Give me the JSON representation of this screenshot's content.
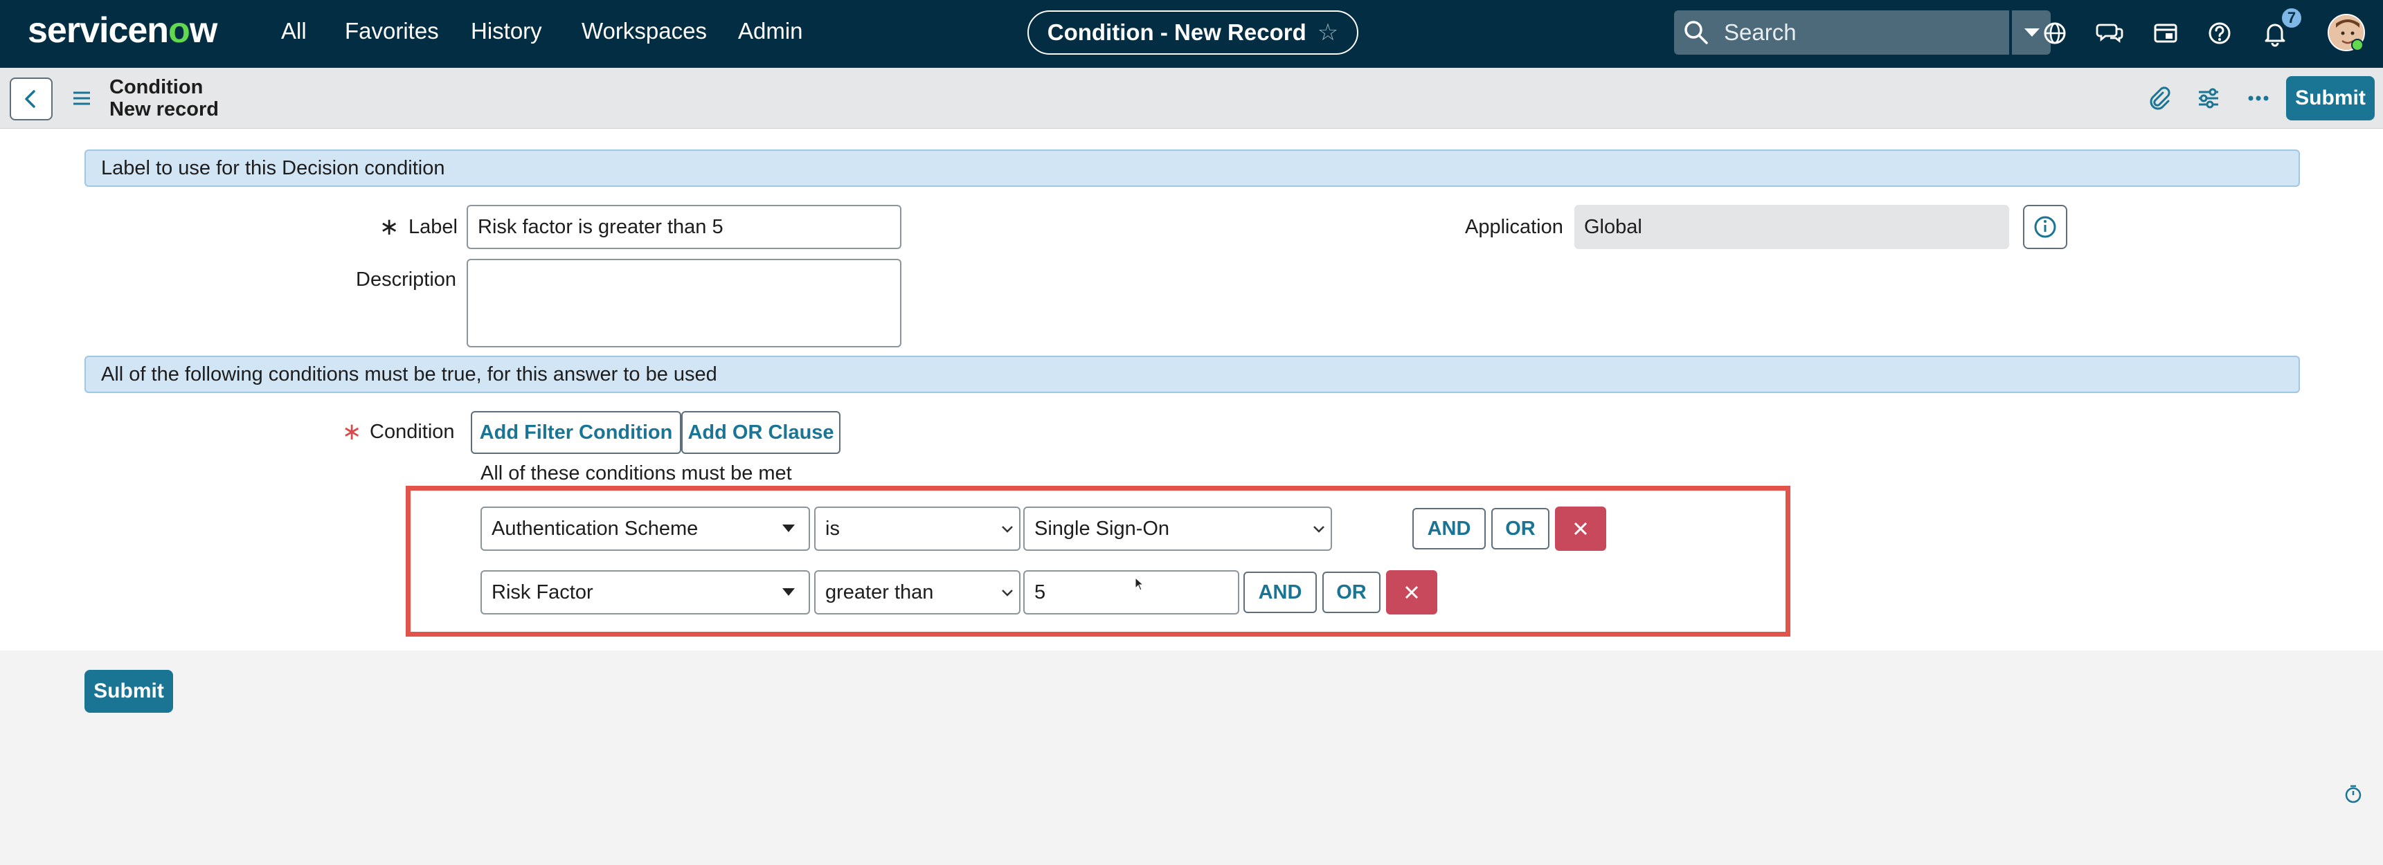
{
  "topnav": {
    "logo": "servicenow",
    "links": [
      "All",
      "Favorites",
      "History",
      "Workspaces",
      "Admin"
    ],
    "record_title": "Condition - New Record",
    "search_placeholder": "Search",
    "notification_count": "7"
  },
  "header": {
    "breadcrumb_table": "Condition",
    "breadcrumb_record": "New record",
    "submit_label": "Submit"
  },
  "form": {
    "section1": "Label to use for this Decision condition",
    "label_label": "Label",
    "label_value": "Risk factor is greater than 5",
    "application_label": "Application",
    "application_value": "Global",
    "description_label": "Description",
    "description_value": "",
    "section2": "All of the following conditions must be true, for this answer to be used",
    "condition_label": "Condition",
    "add_filter_label": "Add Filter Condition",
    "add_or_label": "Add OR Clause",
    "conditions_hint": "All of these conditions must be met",
    "rows": [
      {
        "field": "Authentication Scheme",
        "operator": "is",
        "value": "Single Sign-On",
        "and": "AND",
        "or": "OR"
      },
      {
        "field": "Risk Factor",
        "operator": "greater than",
        "value": "5",
        "and": "AND",
        "or": "OR"
      }
    ],
    "submit_label": "Submit"
  },
  "colors": {
    "nav_bg": "#032d42",
    "accent": "#1a7595",
    "highlight": "#e2534a",
    "delete": "#c8495c",
    "section_bg": "#d2e5f5"
  }
}
